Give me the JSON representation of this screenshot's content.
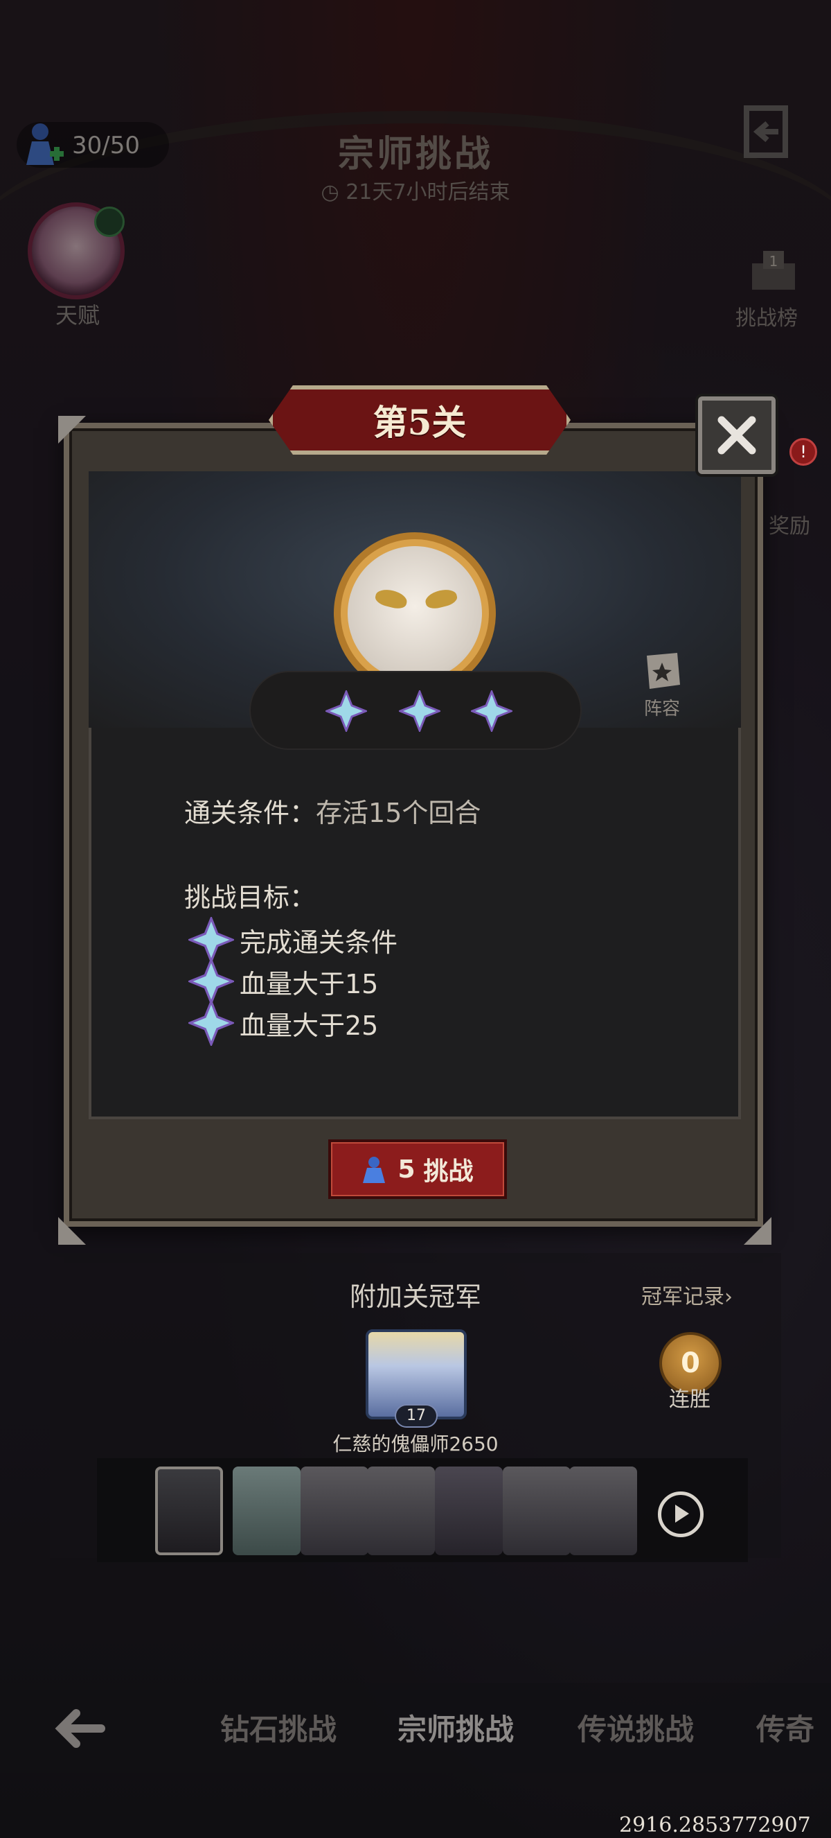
{
  "header": {
    "stamina": "30/50",
    "title": "宗师挑战",
    "timer": "21天7小时后结束"
  },
  "left_hud": {
    "talent_label": "天赋"
  },
  "right_hud": {
    "leaderboard_label": "挑战榜",
    "leaderboard_rank": "1",
    "reward_label": "奖励",
    "reward_alert": "!"
  },
  "dialog": {
    "stage_title": "第5关",
    "lineup_label": "阵容",
    "stars_earned": 3,
    "clear_condition_label": "通关条件：",
    "clear_condition_value": "存活15个回合",
    "goals_label": "挑战目标：",
    "goals": [
      "完成通关条件",
      "血量大于15",
      "血量大于25"
    ],
    "challenge_cost": "5",
    "challenge_label": "挑战"
  },
  "champion": {
    "title": "附加关冠军",
    "record_link": "冠军记录›",
    "level": "17",
    "name": "仁慈的傀儡师2650",
    "streak_value": "0",
    "streak_label": "连胜"
  },
  "bottom_nav": {
    "tabs": [
      "钻石挑战",
      "宗师挑战",
      "传说挑战",
      "传奇"
    ]
  },
  "coordinates_readout": "2916.2853772907",
  "colors": {
    "accent_red": "#8c1c1c",
    "banner_red": "#6b1414",
    "gold": "#d9a14a"
  }
}
